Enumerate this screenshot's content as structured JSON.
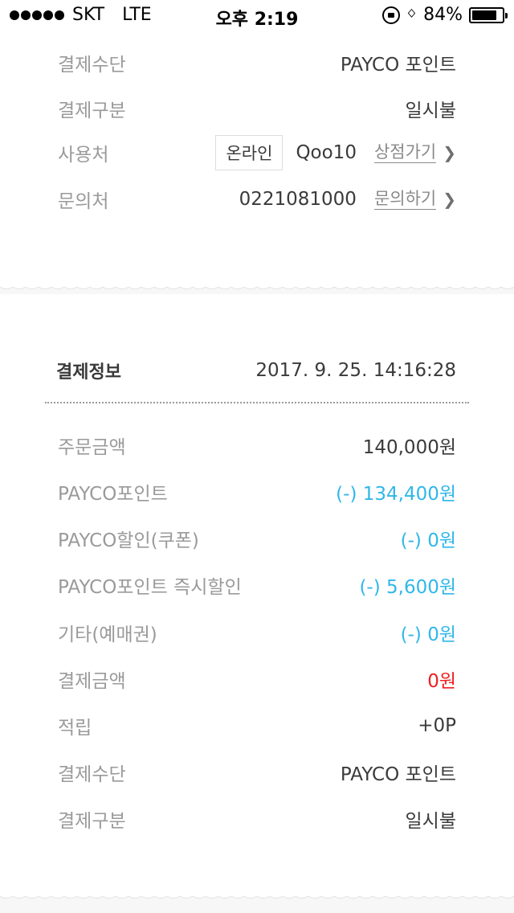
{
  "status_bar": {
    "carrier": "SKT",
    "network": "LTE",
    "time": "오후 2:19",
    "battery": "84%",
    "battery_level": 0.84,
    "icons": [
      "orientation-lock-icon",
      "bluetooth-icon",
      "battery-icon"
    ]
  },
  "top_section": {
    "rows": [
      {
        "label": "결제수단",
        "value": "PAYCO 포인트"
      },
      {
        "label": "결제구분",
        "value": "일시불"
      }
    ],
    "store": {
      "label": "사용처",
      "tag": "온라인",
      "name": "Qoo10",
      "link": "상점가기"
    },
    "contact": {
      "label": "문의처",
      "phone": "0221081000",
      "link": "문의하기"
    }
  },
  "payment_info": {
    "title": "결제정보",
    "datetime": "2017. 9. 25. 14:16:28",
    "rows": [
      {
        "label": "주문금액",
        "value": "140,000원"
      },
      {
        "label": "PAYCO포인트",
        "value": "(-) 134,400원"
      },
      {
        "label": "PAYCO할인(쿠폰)",
        "value": "(-) 0원"
      },
      {
        "label": "PAYCO포인트 즉시할인",
        "value": "(-) 5,600원"
      },
      {
        "label": "기타(예매권)",
        "value": "(-) 0원"
      },
      {
        "label": "결제금액",
        "value": "0원"
      },
      {
        "label": "적립",
        "value": "+0P"
      },
      {
        "label": "결제수단",
        "value": "PAYCO 포인트"
      },
      {
        "label": "결제구분",
        "value": "일시불"
      }
    ]
  },
  "colors": {
    "discount_blue": "#2fb7ea",
    "total_red": "#ee1f1f",
    "label_gray": "#9a9a9a",
    "value_dark": "#3a3a3a"
  }
}
